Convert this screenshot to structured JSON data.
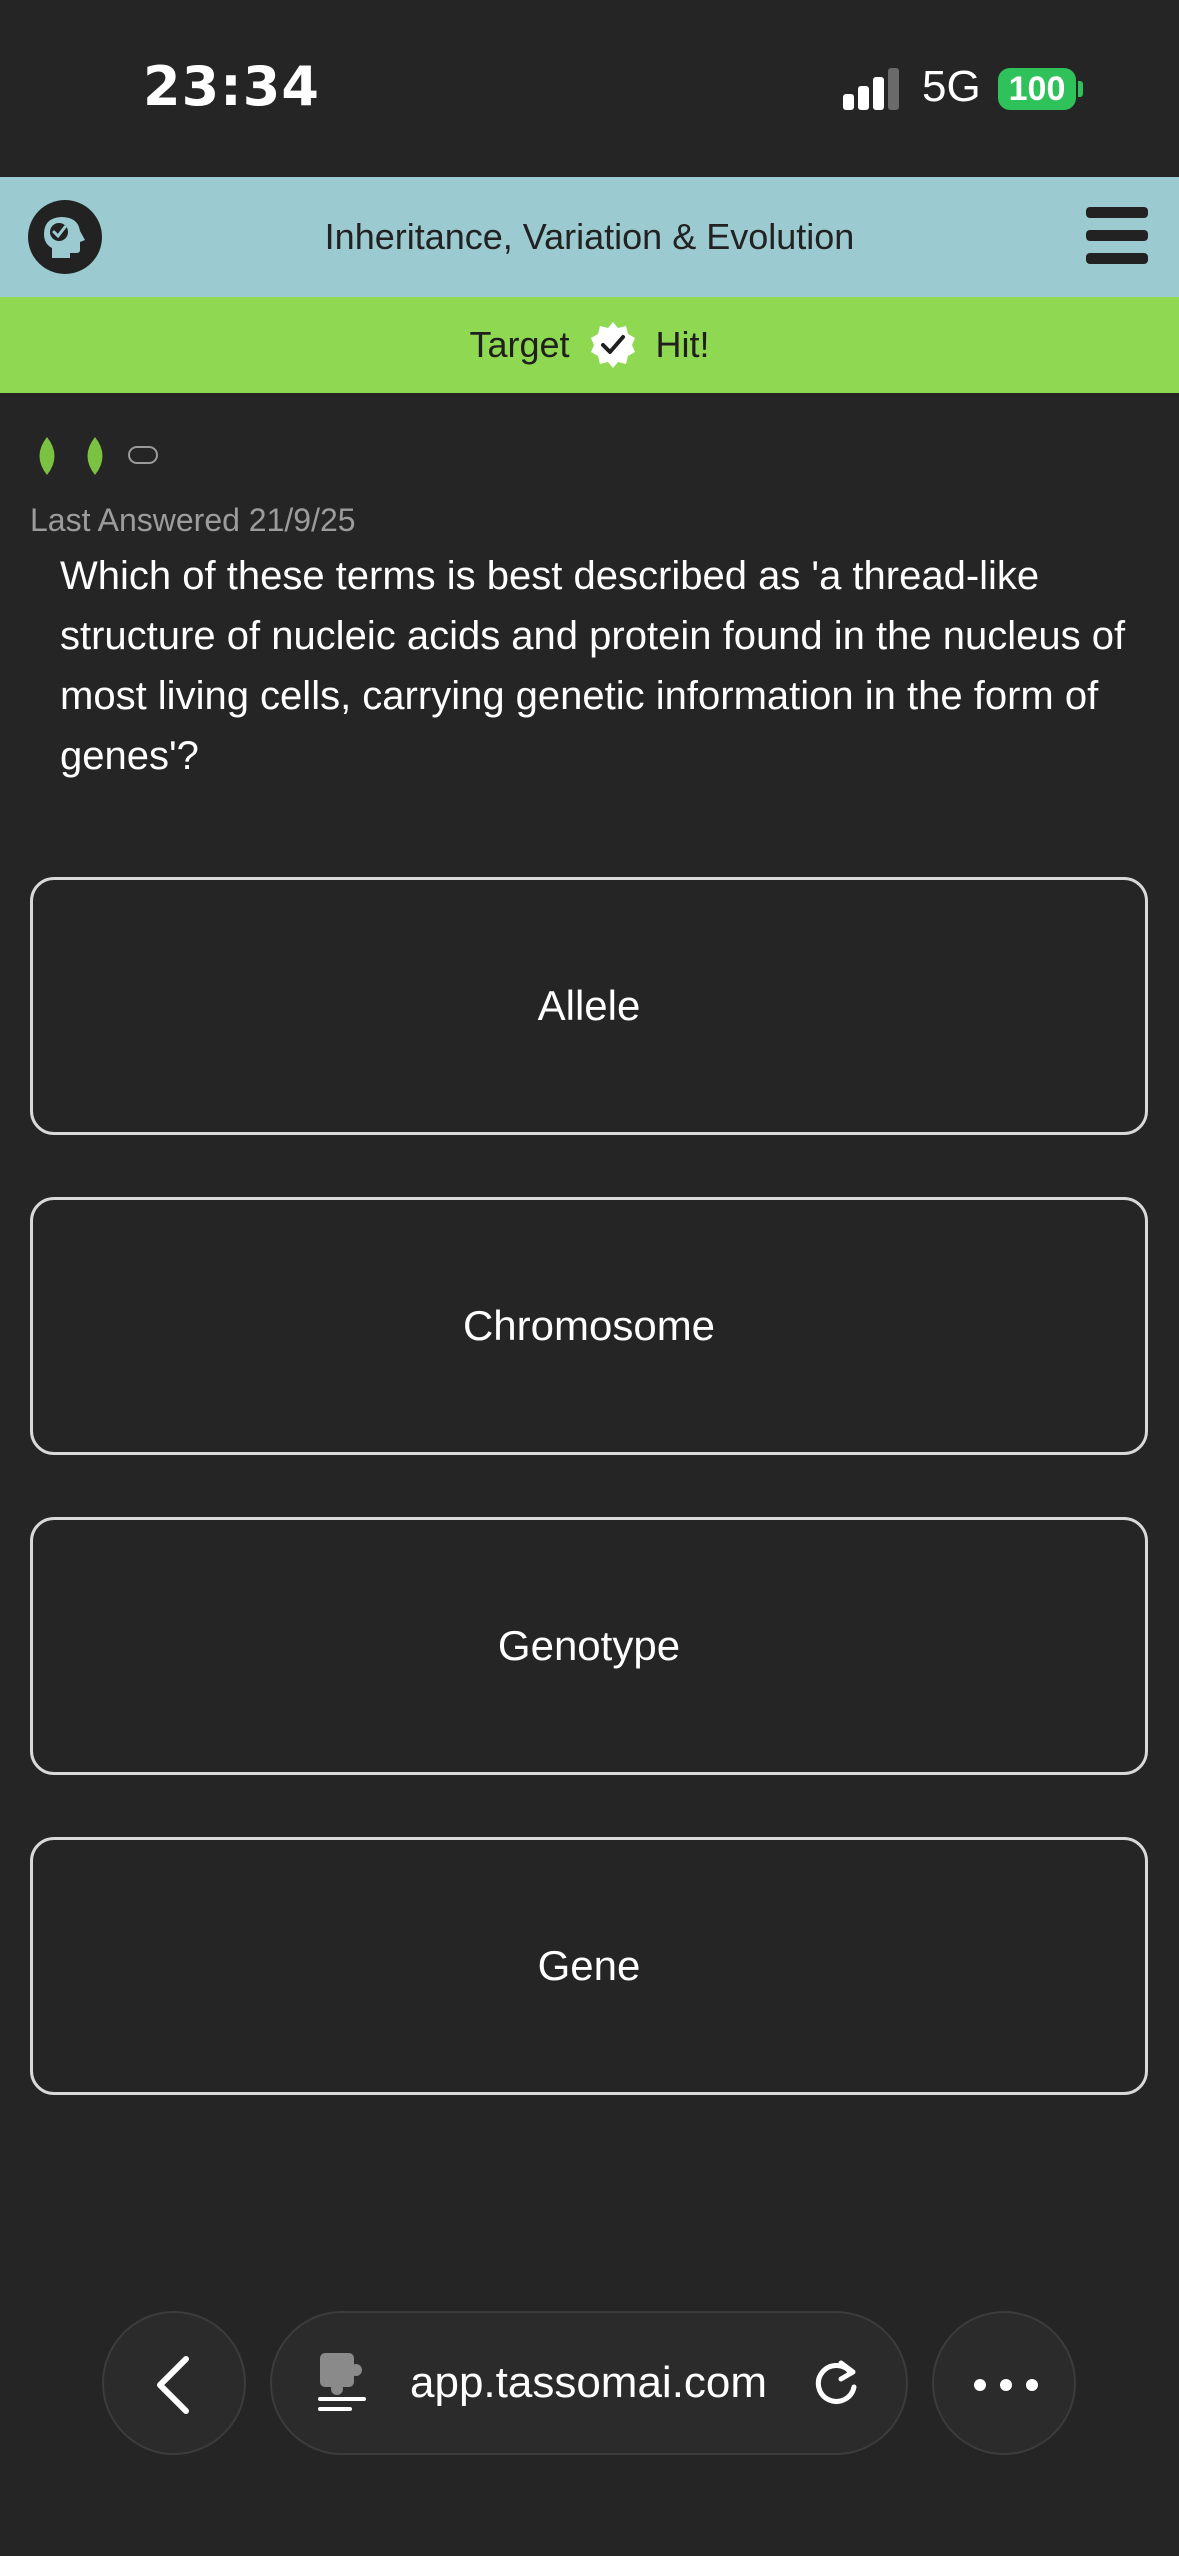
{
  "status_bar": {
    "time": "23:34",
    "network": "5G",
    "battery": "100"
  },
  "header": {
    "title": "Inheritance, Variation & Evolution"
  },
  "banner": {
    "left": "Target",
    "right": "Hit!"
  },
  "progress": {
    "filled": 2,
    "total": 3
  },
  "last_answered": "Last Answered 21/9/25",
  "question": "Which of these terms is best described as 'a thread-like structure of nucleic acids and protein found in the nucleus of most living cells, carrying genetic information in the form of genes'?",
  "answers": [
    "Allele",
    "Chromosome",
    "Genotype",
    "Gene"
  ],
  "browser": {
    "url": "app.tassomai.com"
  },
  "colors": {
    "header": "#9bcbd0",
    "banner": "#8fd852",
    "background": "#252525",
    "leaf": "#7cc242"
  }
}
